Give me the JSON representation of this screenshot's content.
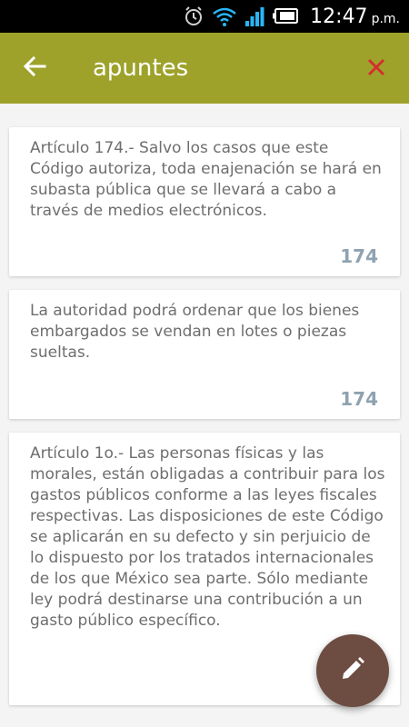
{
  "status_bar": {
    "time": "12:47",
    "ampm": "p.m.",
    "icons": [
      "alarm-icon",
      "wifi-icon",
      "signal-icon",
      "battery-icon"
    ]
  },
  "app_bar": {
    "title": "apuntes",
    "back_icon": "arrow-back-icon",
    "close_icon": "close-icon",
    "color": "#9ea22a",
    "close_color": "#d32f2f"
  },
  "notes": [
    {
      "text": "Artículo 174.- Salvo los casos que este Código autoriza, toda enajenación se hará en subasta pública que se llevará a cabo a través de medios electrónicos.",
      "number": "174"
    },
    {
      "text": "La autoridad podrá ordenar que los bienes embargados se vendan en lotes o piezas sueltas.",
      "number": "174"
    },
    {
      "text": "Artículo 1o.- Las personas físicas y las morales, están obligadas a contribuir para los gastos públicos conforme a las leyes fiscales respectivas. Las disposiciones de este Código se aplicarán en su defecto y sin perjuicio de lo dispuesto por los tratados internacionales de los que México sea parte. Sólo mediante ley podrá destinarse una contribución a un gasto público específico.",
      "number": ""
    }
  ],
  "fab": {
    "icon": "pencil-edit-icon",
    "color": "#6d4c41"
  }
}
